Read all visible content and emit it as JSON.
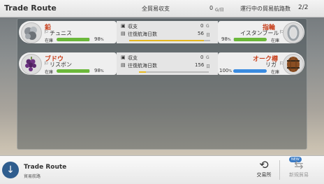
{
  "header": {
    "title": "Trade Route",
    "balance_label": "全貿易収支",
    "balance_value": "0",
    "balance_unit": "G/日",
    "routes_label": "運行中の貿易航路数",
    "routes_value": "2/2"
  },
  "routes": [
    {
      "source": {
        "good": "鉛",
        "city": "チュニス",
        "stock_label": "在庫",
        "stock_pct": 98,
        "stock_pct_text": "98",
        "pct_sign": "%",
        "bar_color": "#6bb83a",
        "icon": "lead-ore-icon"
      },
      "middle": {
        "income_label": "収支",
        "income_value": "0",
        "income_unit": "G",
        "days_label": "往復航海日数",
        "days_value": "56",
        "days_unit": "日",
        "progress": 0.92
      },
      "dest": {
        "good": "指輪",
        "city": "イスタンブール",
        "stock_label": "在庫",
        "stock_pct": 98,
        "stock_pct_text": "98",
        "pct_sign": "%",
        "bar_color": "#6bb83a",
        "icon": "ring-icon"
      }
    },
    {
      "source": {
        "good": "ブドウ",
        "city": "リスボン",
        "stock_label": "在庫",
        "stock_pct": 98,
        "stock_pct_text": "98",
        "pct_sign": "%",
        "bar_color": "#6bb83a",
        "icon": "grapes-icon"
      },
      "middle": {
        "income_label": "収支",
        "income_value": "0",
        "income_unit": "G",
        "days_label": "往復航海日数",
        "days_value": "156",
        "days_unit": "日",
        "progress": 0.1
      },
      "dest": {
        "good": "オーク樽",
        "city": "リガ",
        "stock_label": "在庫",
        "stock_pct": 100,
        "stock_pct_text": "100",
        "pct_sign": "%",
        "bar_color": "#3a8be0",
        "icon": "oak-barrel-icon"
      }
    }
  ],
  "footer": {
    "title": "Trade Route",
    "subtitle": "貿易航路",
    "exchange_label": "交易所",
    "new_trade_label": "新規貿易",
    "new_badge": "NEW"
  }
}
